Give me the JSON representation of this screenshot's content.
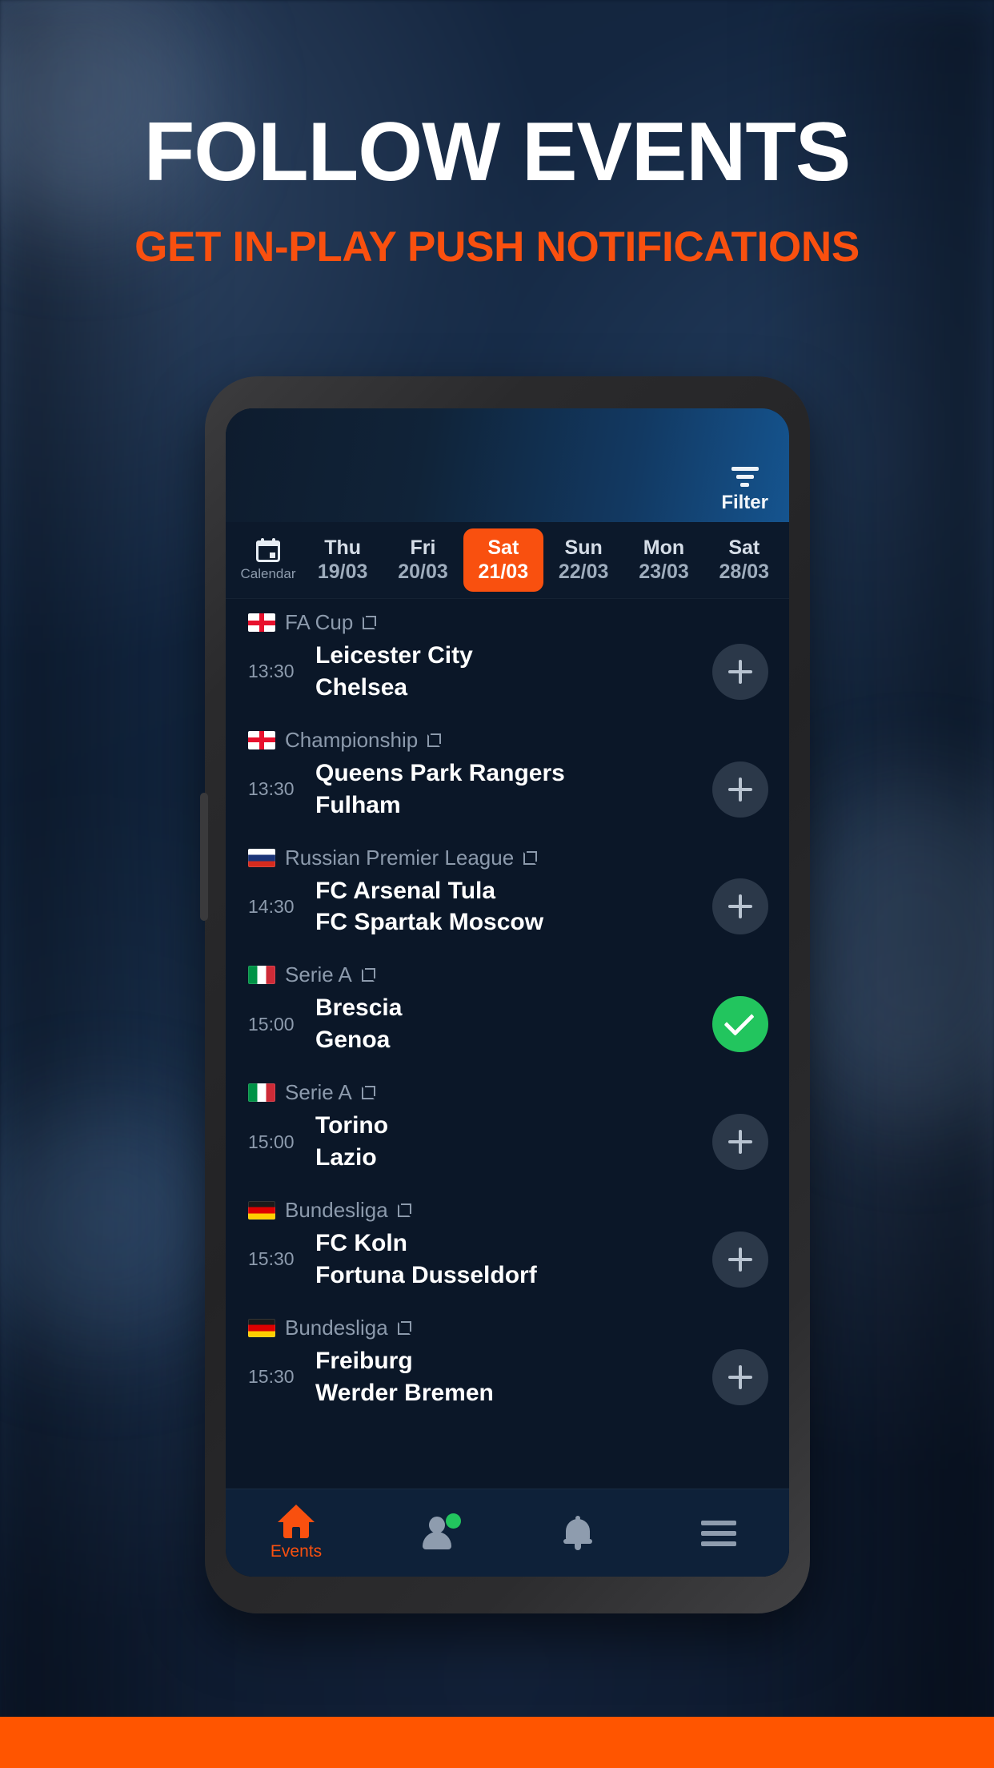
{
  "promo": {
    "headline": "FOLLOW EVENTS",
    "subheadline": "GET IN-PLAY PUSH NOTIFICATIONS",
    "accent_color": "#f9500f",
    "band_color": "#ff5500"
  },
  "app": {
    "header": {
      "filter_label": "Filter",
      "filter_icon": "filter-icon"
    },
    "date_strip": {
      "calendar_label": "Calendar",
      "calendar_icon": "calendar-icon",
      "dates": [
        {
          "dow": "Thu",
          "date": "19/03",
          "selected": false
        },
        {
          "dow": "Fri",
          "date": "20/03",
          "selected": false
        },
        {
          "dow": "Sat",
          "date": "21/03",
          "selected": true
        },
        {
          "dow": "Sun",
          "date": "22/03",
          "selected": false
        },
        {
          "dow": "Mon",
          "date": "23/03",
          "selected": false
        },
        {
          "dow": "Sat",
          "date": "28/03",
          "selected": false
        }
      ]
    },
    "matches": [
      {
        "league": "FA Cup",
        "flag": "eng",
        "link_icon": "external-link-icon",
        "time": "13:30",
        "home": "Leicester City",
        "away": "Chelsea",
        "action": "add",
        "action_icon": "plus-icon"
      },
      {
        "league": "Championship",
        "flag": "eng",
        "link_icon": "external-link-icon",
        "time": "13:30",
        "home": "Queens Park Rangers",
        "away": "Fulham",
        "action": "add",
        "action_icon": "plus-icon"
      },
      {
        "league": "Russian Premier League",
        "flag": "rus",
        "link_icon": "external-link-icon",
        "time": "14:30",
        "home": "FC Arsenal Tula",
        "away": "FC Spartak Moscow",
        "action": "add",
        "action_icon": "plus-icon"
      },
      {
        "league": "Serie A",
        "flag": "ita",
        "link_icon": "external-link-icon",
        "time": "15:00",
        "home": "Brescia",
        "away": "Genoa",
        "action": "added",
        "action_icon": "check-icon"
      },
      {
        "league": "Serie A",
        "flag": "ita",
        "link_icon": "external-link-icon",
        "time": "15:00",
        "home": "Torino",
        "away": "Lazio",
        "action": "add",
        "action_icon": "plus-icon"
      },
      {
        "league": "Bundesliga",
        "flag": "ger",
        "link_icon": "external-link-icon",
        "time": "15:30",
        "home": "FC Koln",
        "away": "Fortuna Dusseldorf",
        "action": "add",
        "action_icon": "plus-icon"
      },
      {
        "league": "Bundesliga",
        "flag": "ger",
        "link_icon": "external-link-icon",
        "time": "15:30",
        "home": "Freiburg",
        "away": "Werder Bremen",
        "action": "add",
        "action_icon": "plus-icon"
      }
    ],
    "bottom_nav": [
      {
        "label": "Events",
        "icon": "home-icon",
        "active": true,
        "badge": false
      },
      {
        "label": "",
        "icon": "person-icon",
        "active": false,
        "badge": true
      },
      {
        "label": "",
        "icon": "bell-icon",
        "active": false,
        "badge": false
      },
      {
        "label": "",
        "icon": "hamburger-menu-icon",
        "active": false,
        "badge": false
      }
    ],
    "colors": {
      "accent": "#f9500f",
      "added": "#22c55e",
      "add_button": "#2b3849",
      "screen_bg": "#0b1728"
    }
  }
}
